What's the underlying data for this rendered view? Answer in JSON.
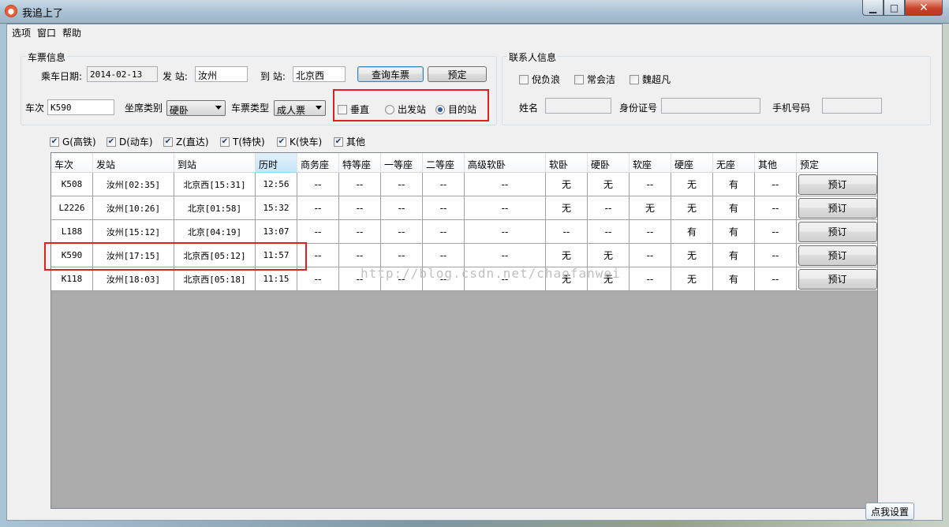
{
  "window": {
    "title": "我追上了"
  },
  "menu": [
    "选项",
    "窗口",
    "帮助"
  ],
  "ticket_group": {
    "title": "车票信息",
    "date_label": "乘车日期:",
    "date_value": "2014-02-13",
    "from_label": "发 站:",
    "from_value": "汝州",
    "to_label": "到 站:",
    "to_value": "北京西",
    "query_button": "查询车票",
    "book_button": "预定",
    "train_label": "车次",
    "train_value": "K590",
    "seat_label": "坐席类别",
    "seat_value": "硬卧",
    "ticket_type_label": "车票类型",
    "ticket_type_value": "成人票",
    "vertical_label": "垂直",
    "depart_radio": "出发站",
    "dest_radio": "目的站"
  },
  "contact_group": {
    "title": "联系人信息",
    "contacts": [
      "倪负浪",
      "常会洁",
      "魏超凡"
    ],
    "name_label": "姓名",
    "id_label": "身份证号",
    "phone_label": "手机号码"
  },
  "filters": [
    "G(高铁)",
    "D(动车)",
    "Z(直达)",
    "T(特快)",
    "K(快车)",
    "其他"
  ],
  "table": {
    "headers": [
      "车次",
      "发站",
      "到站",
      "历时",
      "商务座",
      "特等座",
      "一等座",
      "二等座",
      "高级软卧",
      "软卧",
      "硬卧",
      "软座",
      "硬座",
      "无座",
      "其他",
      "预定"
    ],
    "rows": [
      [
        "K508",
        "汝州[02:35]",
        "北京西[15:31]",
        "12:56",
        "--",
        "--",
        "--",
        "--",
        "--",
        "无",
        "无",
        "--",
        "无",
        "有",
        "--",
        "预订"
      ],
      [
        "L2226",
        "汝州[10:26]",
        "北京[01:58]",
        "15:32",
        "--",
        "--",
        "--",
        "--",
        "--",
        "无",
        "--",
        "无",
        "无",
        "有",
        "--",
        "预订"
      ],
      [
        "L188",
        "汝州[15:12]",
        "北京[04:19]",
        "13:07",
        "--",
        "--",
        "--",
        "--",
        "--",
        "--",
        "--",
        "--",
        "有",
        "有",
        "--",
        "预订"
      ],
      [
        "K590",
        "汝州[17:15]",
        "北京西[05:12]",
        "11:57",
        "--",
        "--",
        "--",
        "--",
        "--",
        "无",
        "无",
        "--",
        "无",
        "有",
        "--",
        "预订"
      ],
      [
        "K118",
        "汝州[18:03]",
        "北京西[05:18]",
        "11:15",
        "--",
        "--",
        "--",
        "--",
        "--",
        "无",
        "无",
        "--",
        "无",
        "有",
        "--",
        "预订"
      ]
    ]
  },
  "watermark": "http://blog.csdn.net/chaofanwei",
  "balloon": "点我设置"
}
